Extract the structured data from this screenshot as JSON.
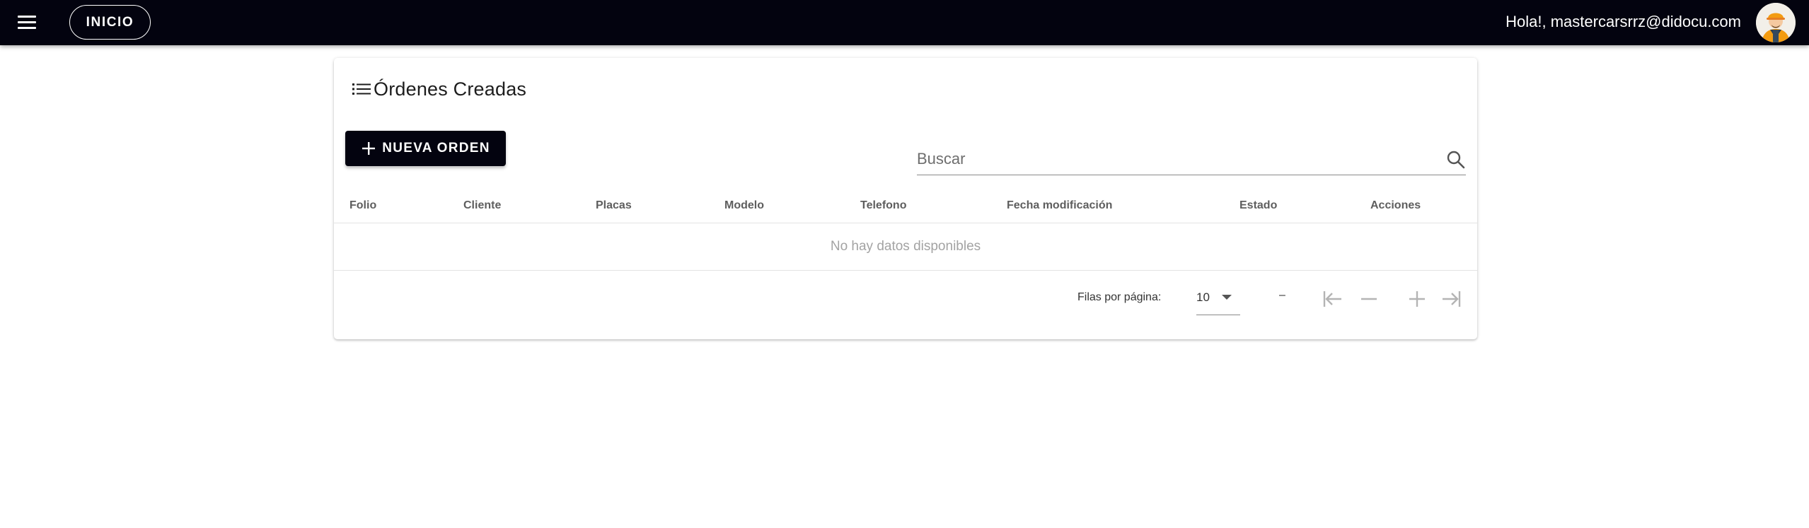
{
  "header": {
    "menu_icon": "hamburger-menu-icon",
    "home_button": "INICIO",
    "greeting": "Hola!, mastercarsrrz@didocu.com",
    "avatar_icon": "user-avatar-icon"
  },
  "card": {
    "title_icon": "list-icon",
    "title": "Órdenes Creadas",
    "new_order_button": "NUEVA ORDEN",
    "search_placeholder": "Buscar"
  },
  "table": {
    "columns": [
      "Folio",
      "Cliente",
      "Placas",
      "Modelo",
      "Telefono",
      "Fecha modificación",
      "Estado",
      "Acciones"
    ],
    "empty_message": "No hay datos disponibles"
  },
  "pagination": {
    "rows_per_page_label": "Filas por página:",
    "rows_per_page_value": "10",
    "range_text": "–"
  },
  "colors": {
    "appbar": "#03030f",
    "primary_button": "#03030f",
    "text_muted": "#a3a3a3"
  }
}
